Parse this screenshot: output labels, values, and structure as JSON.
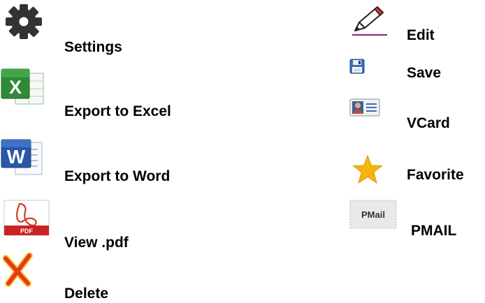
{
  "legend": {
    "left_column": [
      {
        "label": "Settings",
        "icon": "gear-icon"
      },
      {
        "label": "Export to Excel",
        "icon": "excel-icon"
      },
      {
        "label": "Export to Word",
        "icon": "word-icon"
      },
      {
        "label": "View .pdf",
        "icon": "pdf-icon"
      },
      {
        "label": "Delete",
        "icon": "delete-x-icon"
      }
    ],
    "right_column": [
      {
        "label": "Edit",
        "icon": "pencil-icon"
      },
      {
        "label": "Save",
        "icon": "floppy-disk-icon"
      },
      {
        "label": "VCard",
        "icon": "vcard-icon"
      },
      {
        "label": "Favorite",
        "icon": "star-icon"
      },
      {
        "label": "PMAIL",
        "icon": "pmail-icon",
        "icon_text": "PMail"
      }
    ]
  }
}
